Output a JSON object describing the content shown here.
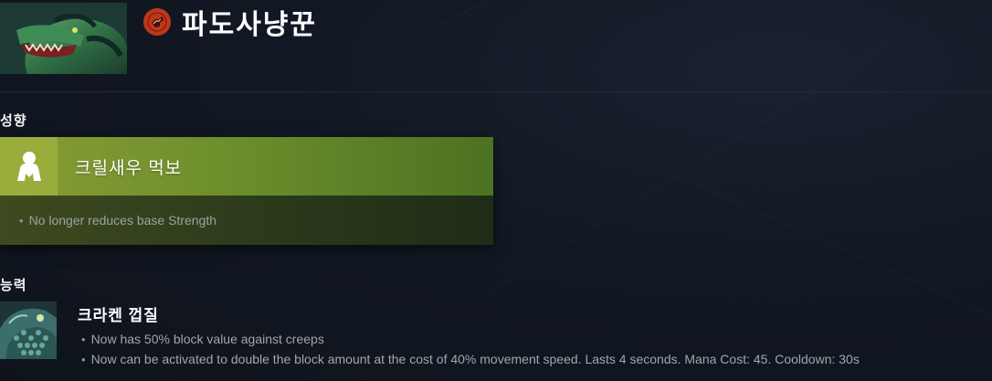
{
  "hero": {
    "name": "파도사냥꾼",
    "portrait_icon": "tidehunter-portrait",
    "attribute_icon": "strength-attribute-icon",
    "attribute_color": "#c0371b"
  },
  "facet_section": {
    "heading": "성향",
    "facet": {
      "name": "크릴새우 먹보",
      "icon": "person-silhouette-icon",
      "color": "#8a9d35",
      "notes": [
        "No longer reduces base Strength"
      ]
    }
  },
  "abilities_section": {
    "heading": "능력",
    "ability": {
      "name": "크라켄 껍질",
      "icon": "kraken-shell-icon",
      "notes": [
        "Now has 50% block value against creeps",
        "Now can be activated to double the block amount at the cost of 40% movement speed. Lasts 4 seconds. Mana Cost: 45. Cooldown: 30s"
      ]
    }
  }
}
